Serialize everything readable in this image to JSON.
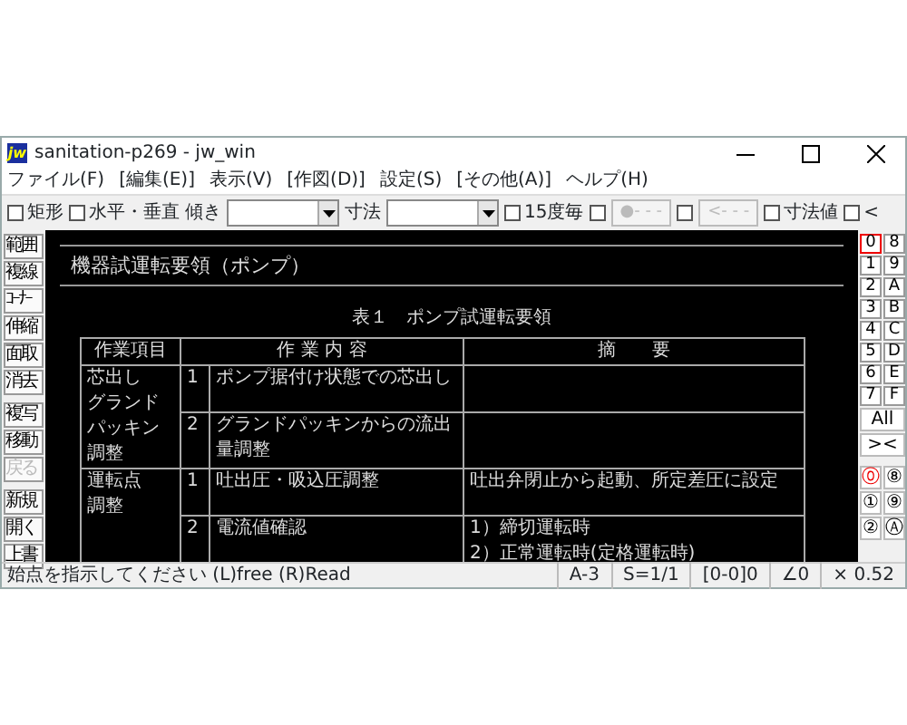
{
  "window": {
    "title": "sanitation-p269 - jw_win",
    "logo": "jw"
  },
  "menu": [
    "ファイル(F)",
    "[編集(E)]",
    "表示(V)",
    "[作図(D)]",
    "設定(S)",
    "[その他(A)]",
    "ヘルプ(H)"
  ],
  "toolbar": [
    {
      "kind": "check",
      "label": "矩形",
      "checked": false
    },
    {
      "kind": "check",
      "label": "水平・垂直",
      "checked": false
    },
    {
      "kind": "combo",
      "label": "傾き"
    },
    {
      "kind": "combo",
      "label": "寸法"
    },
    {
      "kind": "check",
      "label": "15度毎",
      "checked": false
    },
    {
      "kind": "check",
      "checked": false
    },
    {
      "kind": "button",
      "label": "●- - -",
      "disabled": true
    },
    {
      "kind": "check",
      "checked": false
    },
    {
      "kind": "button",
      "label": "<- - -",
      "disabled": true
    },
    {
      "kind": "check",
      "label": "寸法値",
      "checked": false
    },
    {
      "kind": "check",
      "label": "<",
      "checked": false
    }
  ],
  "tools": [
    {
      "label": "範囲",
      "disabled": false
    },
    {
      "label": "複線",
      "disabled": false
    },
    {
      "label": "ｺｰﾅｰ",
      "disabled": false
    },
    {
      "label": "伸縮",
      "disabled": false
    },
    {
      "label": "面取",
      "disabled": false
    },
    {
      "label": "消去",
      "disabled": false
    },
    {
      "label": "複写",
      "disabled": false
    },
    {
      "label": "移動",
      "disabled": false
    },
    {
      "label": "戻る",
      "disabled": true
    },
    {
      "label": "新規",
      "disabled": false
    },
    {
      "label": "開く",
      "disabled": false
    },
    {
      "label": "上書",
      "disabled": false
    }
  ],
  "drawing": {
    "title": "機器試運転要領（ポンプ）",
    "caption": "表１　ポンプ試運転要領",
    "columns": [
      "作業項目",
      "作 業 内 容",
      "摘　　要"
    ],
    "groups": [
      {
        "item": [
          "芯出し",
          "グランド",
          "パッキン",
          "調整"
        ],
        "steps": [
          {
            "no": "1",
            "content": [
              "ポンプ据付け状態での芯出し"
            ]
          },
          {
            "no": "2",
            "content": [
              "グランドパッキンからの流出",
              "量調整"
            ]
          }
        ]
      },
      {
        "item": [
          "運転点",
          "調整"
        ],
        "steps": [
          {
            "no": "1",
            "content": [
              "吐出圧・吸込圧調整"
            ],
            "note": [
              "吐出弁閉止から起動、所定差圧に設定"
            ]
          },
          {
            "no": "2",
            "content": [
              "電流値確認"
            ],
            "note": [
              "1）締切運転時",
              "2）正常運転時(定格運転時)"
            ]
          }
        ]
      }
    ]
  },
  "layers": [
    {
      "label": "0",
      "selected": true
    },
    {
      "label": "8",
      "selected": false
    },
    {
      "label": "1",
      "selected": false
    },
    {
      "label": "9",
      "selected": false
    },
    {
      "label": "2",
      "selected": false
    },
    {
      "label": "A",
      "selected": false
    },
    {
      "label": "3",
      "selected": false
    },
    {
      "label": "B",
      "selected": false
    },
    {
      "label": "4",
      "selected": false
    },
    {
      "label": "C",
      "selected": false
    },
    {
      "label": "5",
      "selected": false
    },
    {
      "label": "D",
      "selected": false
    },
    {
      "label": "6",
      "selected": false
    },
    {
      "label": "E",
      "selected": false
    },
    {
      "label": "7",
      "selected": false
    },
    {
      "label": "F",
      "selected": false
    }
  ],
  "layer_all": "All",
  "layer_swap": "><",
  "layer_groups": [
    {
      "label": "⓪",
      "selected": true
    },
    {
      "label": "⑧",
      "selected": false
    },
    {
      "label": "①",
      "selected": false
    },
    {
      "label": "⑨",
      "selected": false
    },
    {
      "label": "②",
      "selected": false
    },
    {
      "label": "Ⓐ",
      "selected": false
    }
  ],
  "status": {
    "message": "始点を指示してください (L)free (R)Read",
    "fields": [
      "A-3",
      "S=1/1",
      "[0-0]0",
      "∠0",
      "× 0.52"
    ]
  }
}
